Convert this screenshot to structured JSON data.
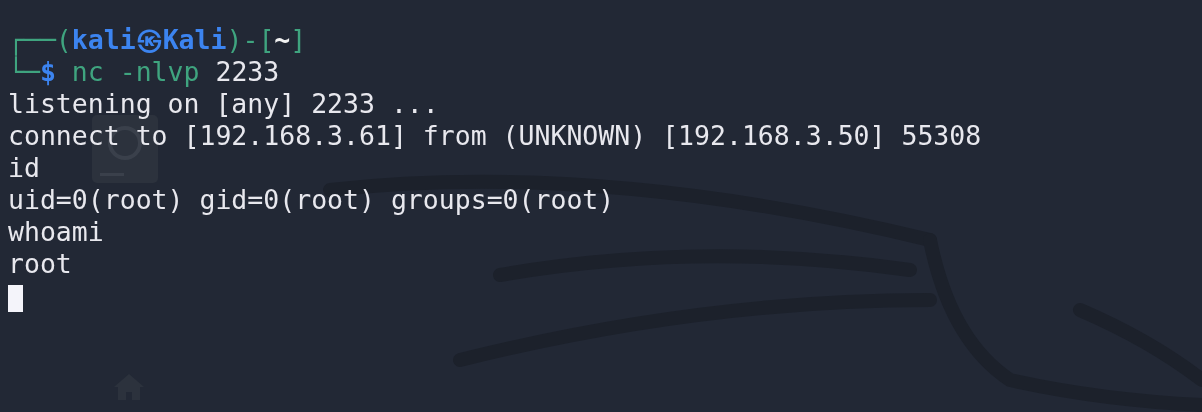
{
  "terminal": {
    "prompt_lines": [
      [
        {
          "kind": "frame",
          "text": "┌──("
        },
        {
          "kind": "user",
          "text": "kali㉿Kali"
        },
        {
          "kind": "frame",
          "text": ")-["
        },
        {
          "kind": "path",
          "text": "~"
        },
        {
          "kind": "frame",
          "text": "]"
        }
      ],
      [
        {
          "kind": "frame",
          "text": "└─"
        },
        {
          "kind": "dollar",
          "text": "$"
        },
        {
          "kind": "command",
          "text": " nc -nlvp"
        },
        {
          "kind": "arg",
          "text": " 2233"
        }
      ]
    ],
    "output": [
      "listening on [any] 2233 ...",
      "connect to [192.168.3.61] from (UNKNOWN) [192.168.3.50] 55308",
      "id",
      "uid=0(root) gid=0(root) groups=0(root)",
      "whoami",
      "root"
    ],
    "cursor": true
  }
}
